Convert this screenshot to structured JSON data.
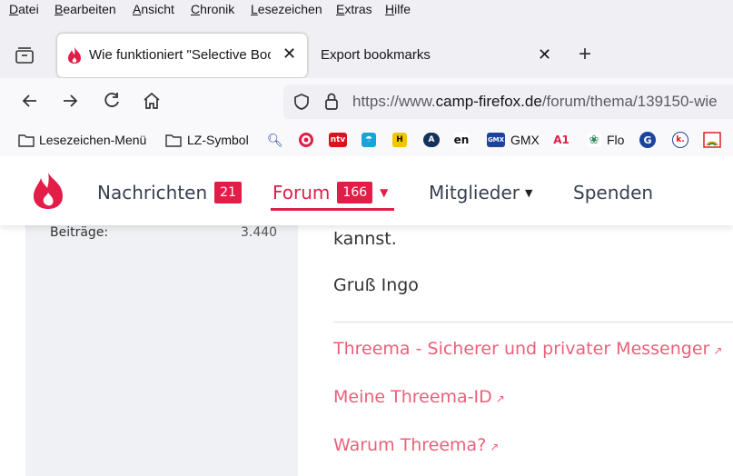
{
  "menu": [
    "Datei",
    "Bearbeiten",
    "Ansicht",
    "Chronik",
    "Lesezeichen",
    "Extras",
    "Hilfe"
  ],
  "tabs": [
    {
      "title": "Wie funktioniert \"Selective Bookmarks Export\""
    },
    {
      "title": "Export bookmarks"
    }
  ],
  "url": {
    "host_prefix": "https://www.",
    "host": "camp-firefox.de",
    "path": "/forum/thema/139150-wie"
  },
  "bookmarks": {
    "menu_label": "Lesezeichen-Menü",
    "folder_label": "LZ-Symbol",
    "gmx_label": "GMX",
    "flo_label": "Flo",
    "fav_text": {
      "ntv": "ntv",
      "h": "H",
      "en": "en",
      "gmx": "GMX",
      "a1": "A1",
      "g": "G",
      "k": "k."
    }
  },
  "site": {
    "nav": {
      "messages": "Nachrichten",
      "messages_count": "21",
      "forum": "Forum",
      "forum_count": "166",
      "members": "Mitglieder",
      "donate": "Spenden"
    }
  },
  "sidebar": {
    "posts_label": "Beiträge:",
    "posts_value": "3.440"
  },
  "post": {
    "line1": "kannst.",
    "greeting": "Gruß Ingo",
    "links": [
      "Threema - Sicherer und privater Messenger",
      "Meine Threema-ID",
      "Warum Threema?"
    ]
  },
  "colors": {
    "accent": "#e11d48",
    "link": "#ec5f7a",
    "flame": "#e11d48"
  }
}
